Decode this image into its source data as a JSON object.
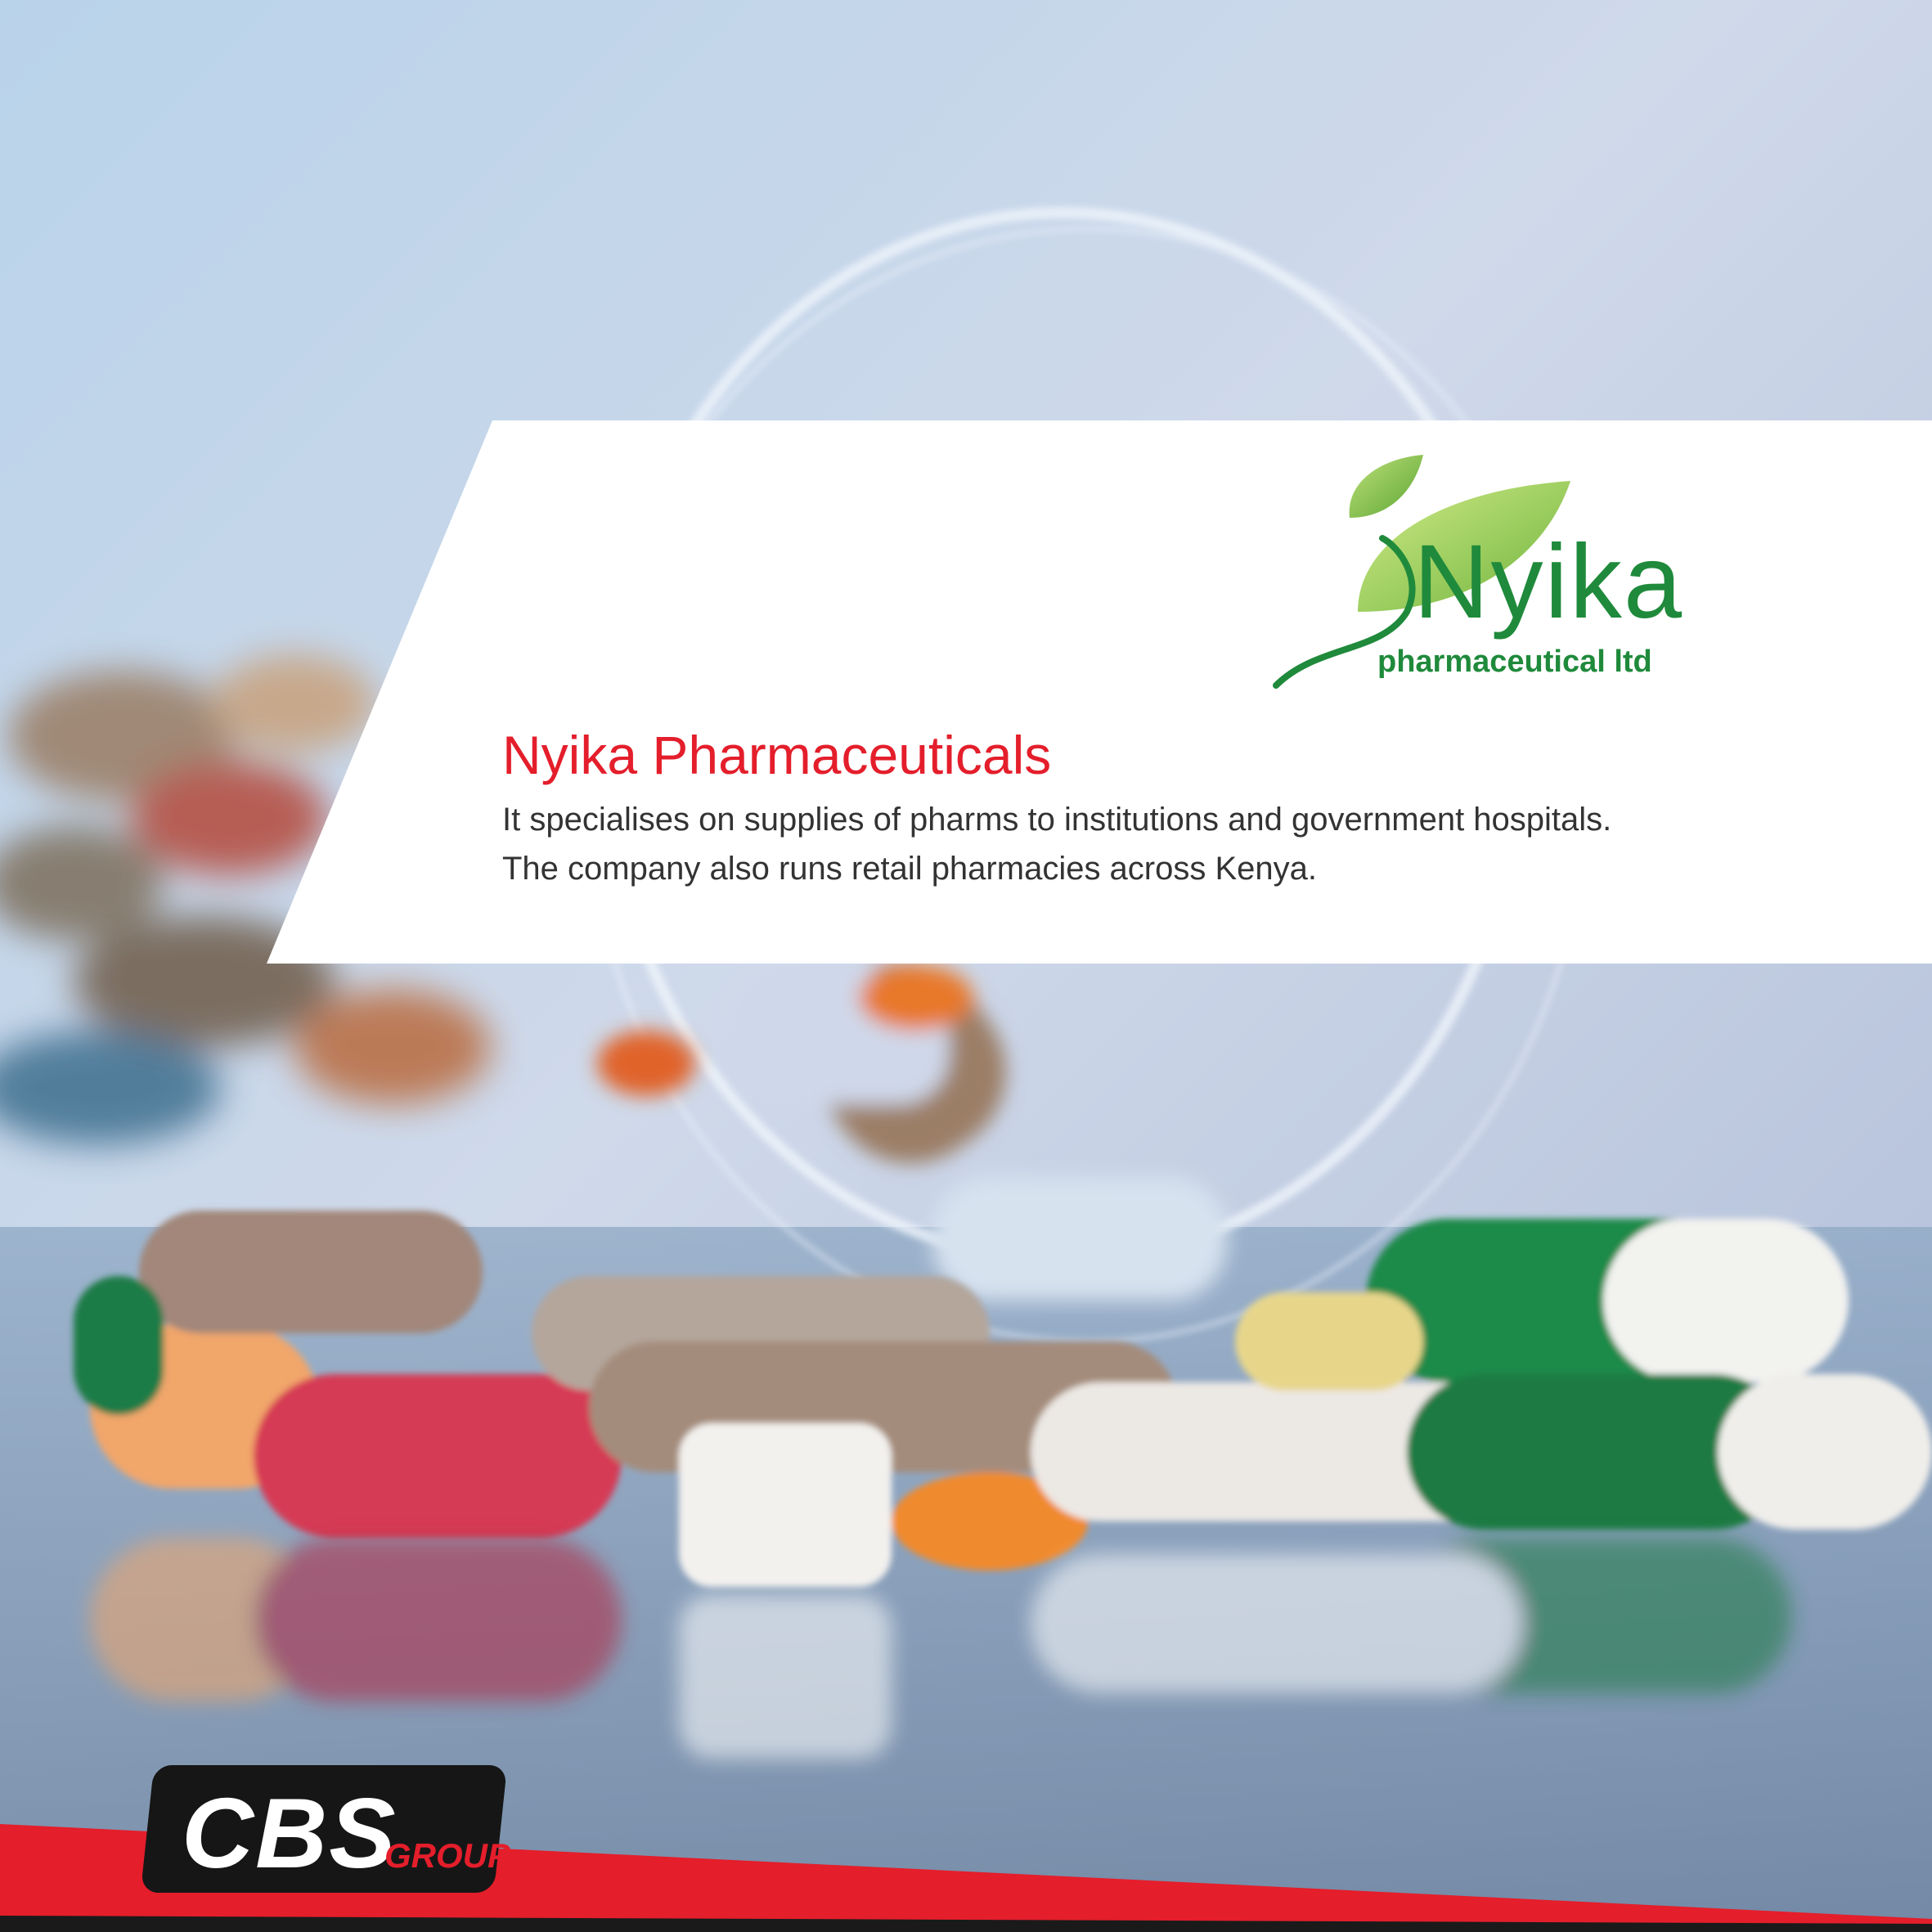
{
  "logo": {
    "word": "Nyika",
    "subtitle": "pharmaceutical ltd",
    "icon": "leaf-icon",
    "color": "#1f8a3b"
  },
  "content": {
    "heading": "Nyika Pharmaceuticals",
    "lines": [
      "It specialises on supplies of pharms to institutions and government hospitals.",
      "The company also runs retail pharmacies across Kenya."
    ],
    "heading_color": "#e41e2b"
  },
  "footer": {
    "brand": "CBS",
    "group": "GROUP",
    "accent": "#e41e2b"
  }
}
